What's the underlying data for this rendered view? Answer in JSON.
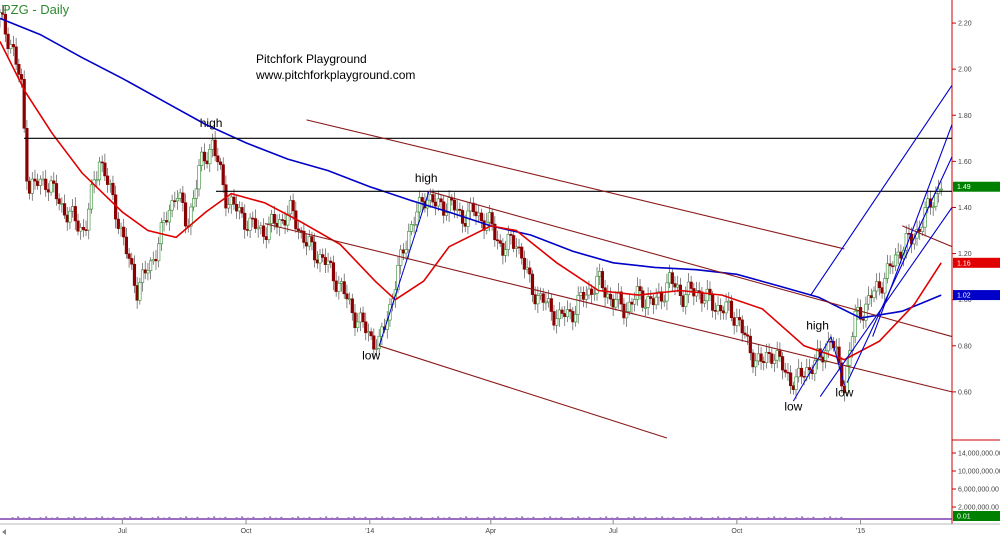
{
  "chart_data": {
    "type": "candlestick",
    "title": "PZG - Daily",
    "subtitle": "Pitchfork Playground",
    "website": "www.pitchforkplayground.com",
    "colors": {
      "title": "#2e8b2e",
      "up": "#2e8b2e",
      "down": "#8b0000",
      "sma_short": "#e00000",
      "sma_long": "#0000c8",
      "horizontal_lines": "#000000",
      "fork_brown": "#8b1a1a",
      "fork_blue": "#0000cc",
      "volume_axis": "#cc0000"
    },
    "price_axis": {
      "min": 0.4,
      "max": 2.3,
      "ticks": [
        0.6,
        0.8,
        1.0,
        1.2,
        1.4,
        1.6,
        1.8,
        2.0,
        2.2
      ],
      "tick_labels": [
        "0.60",
        "0.80",
        "1.00",
        "1.20",
        "1.40",
        "1.60",
        "1.80",
        "2.00",
        "2.20"
      ]
    },
    "volume_axis": {
      "ticks": [
        2000000,
        6000000,
        10000000,
        14000000
      ],
      "tick_labels": [
        "2,000,000.00",
        "6,000,000.00",
        "10,000,000.00",
        "14,000,000.00"
      ]
    },
    "x_axis": {
      "start": "2013-04-01",
      "end": "2015-03-10",
      "ticks": [
        {
          "label": "Jul",
          "date": "2013-07-01"
        },
        {
          "label": "Oct",
          "date": "2013-10-01"
        },
        {
          "label": "'14",
          "date": "2014-01-01"
        },
        {
          "label": "Apr",
          "date": "2014-04-01"
        },
        {
          "label": "Jul",
          "date": "2014-07-01"
        },
        {
          "label": "Oct",
          "date": "2014-10-01"
        },
        {
          "label": "'15",
          "date": "2015-01-01"
        }
      ]
    },
    "price_path": [
      [
        "2013-04-01",
        2.22
      ],
      [
        "2013-04-10",
        2.1
      ],
      [
        "2013-04-17",
        1.92
      ],
      [
        "2013-04-22",
        1.48
      ],
      [
        "2013-05-05",
        1.52
      ],
      [
        "2013-05-20",
        1.38
      ],
      [
        "2013-06-03",
        1.3
      ],
      [
        "2013-06-14",
        1.62
      ],
      [
        "2013-06-28",
        1.35
      ],
      [
        "2013-07-05",
        1.18
      ],
      [
        "2013-07-12",
        1.05
      ],
      [
        "2013-07-22",
        1.15
      ],
      [
        "2013-08-01",
        1.32
      ],
      [
        "2013-08-10",
        1.48
      ],
      [
        "2013-08-18",
        1.32
      ],
      [
        "2013-08-28",
        1.58
      ],
      [
        "2013-09-06",
        1.68
      ],
      [
        "2013-09-16",
        1.45
      ],
      [
        "2013-09-25",
        1.38
      ],
      [
        "2013-10-05",
        1.32
      ],
      [
        "2013-10-15",
        1.3
      ],
      [
        "2013-10-25",
        1.34
      ],
      [
        "2013-11-04",
        1.38
      ],
      [
        "2013-11-15",
        1.24
      ],
      [
        "2013-11-28",
        1.17
      ],
      [
        "2013-12-10",
        1.06
      ],
      [
        "2013-12-20",
        0.94
      ],
      [
        "2013-12-30",
        0.86
      ],
      [
        "2014-01-08",
        0.8
      ],
      [
        "2014-01-15",
        0.95
      ],
      [
        "2014-01-22",
        1.12
      ],
      [
        "2014-01-30",
        1.3
      ],
      [
        "2014-02-06",
        1.38
      ],
      [
        "2014-02-12",
        1.46
      ],
      [
        "2014-02-20",
        1.4
      ],
      [
        "2014-03-01",
        1.42
      ],
      [
        "2014-03-10",
        1.36
      ],
      [
        "2014-03-20",
        1.38
      ],
      [
        "2014-04-01",
        1.32
      ],
      [
        "2014-04-10",
        1.22
      ],
      [
        "2014-04-20",
        1.26
      ],
      [
        "2014-05-01",
        1.05
      ],
      [
        "2014-05-12",
        0.98
      ],
      [
        "2014-05-22",
        0.92
      ],
      [
        "2014-06-01",
        0.95
      ],
      [
        "2014-06-10",
        1.02
      ],
      [
        "2014-06-20",
        1.08
      ],
      [
        "2014-06-30",
        1.0
      ],
      [
        "2014-07-10",
        0.96
      ],
      [
        "2014-07-20",
        1.02
      ],
      [
        "2014-08-01",
        0.98
      ],
      [
        "2014-08-12",
        1.08
      ],
      [
        "2014-08-22",
        1.02
      ],
      [
        "2014-09-02",
        1.04
      ],
      [
        "2014-09-12",
        0.98
      ],
      [
        "2014-09-22",
        0.96
      ],
      [
        "2014-10-02",
        0.92
      ],
      [
        "2014-10-10",
        0.78
      ],
      [
        "2014-10-20",
        0.72
      ],
      [
        "2014-10-28",
        0.78
      ],
      [
        "2014-11-06",
        0.68
      ],
      [
        "2014-11-14",
        0.64
      ],
      [
        "2014-11-22",
        0.7
      ],
      [
        "2014-12-02",
        0.74
      ],
      [
        "2014-12-10",
        0.84
      ],
      [
        "2014-12-16",
        0.7
      ],
      [
        "2014-12-20",
        0.63
      ],
      [
        "2014-12-28",
        0.92
      ],
      [
        "2015-01-06",
        0.98
      ],
      [
        "2015-01-14",
        1.06
      ],
      [
        "2015-01-22",
        1.12
      ],
      [
        "2015-01-30",
        1.22
      ],
      [
        "2015-02-08",
        1.26
      ],
      [
        "2015-02-16",
        1.34
      ],
      [
        "2015-02-24",
        1.44
      ],
      [
        "2015-03-02",
        1.5
      ]
    ],
    "series": [
      {
        "name": "",
        "kind": "sma_long",
        "points": [
          [
            "2013-04-01",
            2.22
          ],
          [
            "2013-05-01",
            2.15
          ],
          [
            "2013-06-01",
            2.05
          ],
          [
            "2013-07-01",
            1.96
          ],
          [
            "2013-08-01",
            1.86
          ],
          [
            "2013-09-01",
            1.76
          ],
          [
            "2013-10-01",
            1.68
          ],
          [
            "2013-11-01",
            1.61
          ],
          [
            "2013-12-01",
            1.56
          ],
          [
            "2014-01-01",
            1.49
          ],
          [
            "2014-02-01",
            1.43
          ],
          [
            "2014-03-01",
            1.38
          ],
          [
            "2014-04-01",
            1.32
          ],
          [
            "2014-05-01",
            1.28
          ],
          [
            "2014-06-01",
            1.21
          ],
          [
            "2014-07-01",
            1.16
          ],
          [
            "2014-08-01",
            1.14
          ],
          [
            "2014-09-01",
            1.13
          ],
          [
            "2014-10-01",
            1.11
          ],
          [
            "2014-11-01",
            1.06
          ],
          [
            "2014-12-01",
            1.01
          ],
          [
            "2015-01-01",
            0.92
          ],
          [
            "2015-02-01",
            0.95
          ],
          [
            "2015-03-02",
            1.02
          ]
        ]
      },
      {
        "name": "",
        "kind": "sma_short",
        "points": [
          [
            "2013-04-01",
            2.12
          ],
          [
            "2013-04-20",
            1.9
          ],
          [
            "2013-05-10",
            1.72
          ],
          [
            "2013-06-01",
            1.55
          ],
          [
            "2013-07-01",
            1.38
          ],
          [
            "2013-07-20",
            1.3
          ],
          [
            "2013-08-10",
            1.27
          ],
          [
            "2013-09-01",
            1.38
          ],
          [
            "2013-09-20",
            1.46
          ],
          [
            "2013-10-15",
            1.42
          ],
          [
            "2013-11-10",
            1.34
          ],
          [
            "2013-12-10",
            1.24
          ],
          [
            "2014-01-05",
            1.08
          ],
          [
            "2014-01-20",
            1.0
          ],
          [
            "2014-02-10",
            1.08
          ],
          [
            "2014-03-01",
            1.23
          ],
          [
            "2014-04-01",
            1.32
          ],
          [
            "2014-04-20",
            1.3
          ],
          [
            "2014-05-20",
            1.16
          ],
          [
            "2014-06-20",
            1.04
          ],
          [
            "2014-07-20",
            1.02
          ],
          [
            "2014-08-20",
            1.04
          ],
          [
            "2014-09-20",
            1.02
          ],
          [
            "2014-10-20",
            0.96
          ],
          [
            "2014-11-20",
            0.8
          ],
          [
            "2014-12-20",
            0.74
          ],
          [
            "2015-01-15",
            0.82
          ],
          [
            "2015-02-10",
            0.98
          ],
          [
            "2015-03-02",
            1.16
          ]
        ]
      }
    ],
    "last_value_badges": [
      {
        "label": "1.49",
        "value": 1.49,
        "color": "#008000"
      },
      {
        "label": "1.16",
        "value": 1.16,
        "color": "#e00000"
      },
      {
        "label": "1.02",
        "value": 1.02,
        "color": "#0000c8"
      },
      {
        "label": "0.01",
        "value": 0.01,
        "color": "#008000",
        "pane": "volume"
      }
    ],
    "horizontal_lines": [
      1.7,
      1.47
    ],
    "pitchforks": [
      {
        "color": "brown",
        "lines": [
          [
            [
              "2013-11-15",
              1.78
            ],
            [
              "2014-12-20",
              1.22
            ]
          ],
          [
            [
              "2014-01-08",
              0.8
            ],
            [
              "2014-08-10",
              0.4
            ]
          ],
          [
            [
              "2014-02-14",
              1.47
            ],
            [
              "2015-03-10",
              0.84
            ]
          ],
          [
            [
              "2013-10-15",
              1.33
            ],
            [
              "2015-03-10",
              0.6
            ]
          ],
          [
            [
              "2015-02-01",
              1.32
            ],
            [
              "2015-03-10",
              1.23
            ]
          ]
        ]
      },
      {
        "color": "blue",
        "lines": [
          [
            [
              "2014-12-02",
              0.58
            ],
            [
              "2015-03-10",
              1.4
            ]
          ],
          [
            [
              "2014-12-22",
              0.64
            ],
            [
              "2015-03-10",
              1.62
            ]
          ],
          [
            [
              "2014-11-25",
              1.02
            ],
            [
              "2015-03-10",
              1.93
            ]
          ],
          [
            [
              "2015-01-10",
              0.84
            ],
            [
              "2015-03-10",
              1.76
            ]
          ]
        ]
      }
    ],
    "pivot_lines": [
      [
        [
          "2014-01-08",
          0.8
        ],
        [
          "2014-02-14",
          1.47
        ]
      ],
      [
        [
          "2014-11-12",
          0.56
        ],
        [
          "2014-12-10",
          0.84
        ]
      ],
      [
        [
          "2014-12-10",
          0.84
        ],
        [
          "2014-12-20",
          0.63
        ]
      ]
    ],
    "annotations": [
      {
        "text": "high",
        "date": "2013-09-05",
        "value": 1.75
      },
      {
        "text": "high",
        "date": "2014-02-12",
        "value": 1.51
      },
      {
        "text": "low",
        "date": "2014-01-02",
        "value": 0.74
      },
      {
        "text": "high",
        "date": "2014-11-30",
        "value": 0.87
      },
      {
        "text": "low",
        "date": "2014-11-12",
        "value": 0.52
      },
      {
        "text": "low",
        "date": "2014-12-20",
        "value": 0.58
      }
    ]
  }
}
